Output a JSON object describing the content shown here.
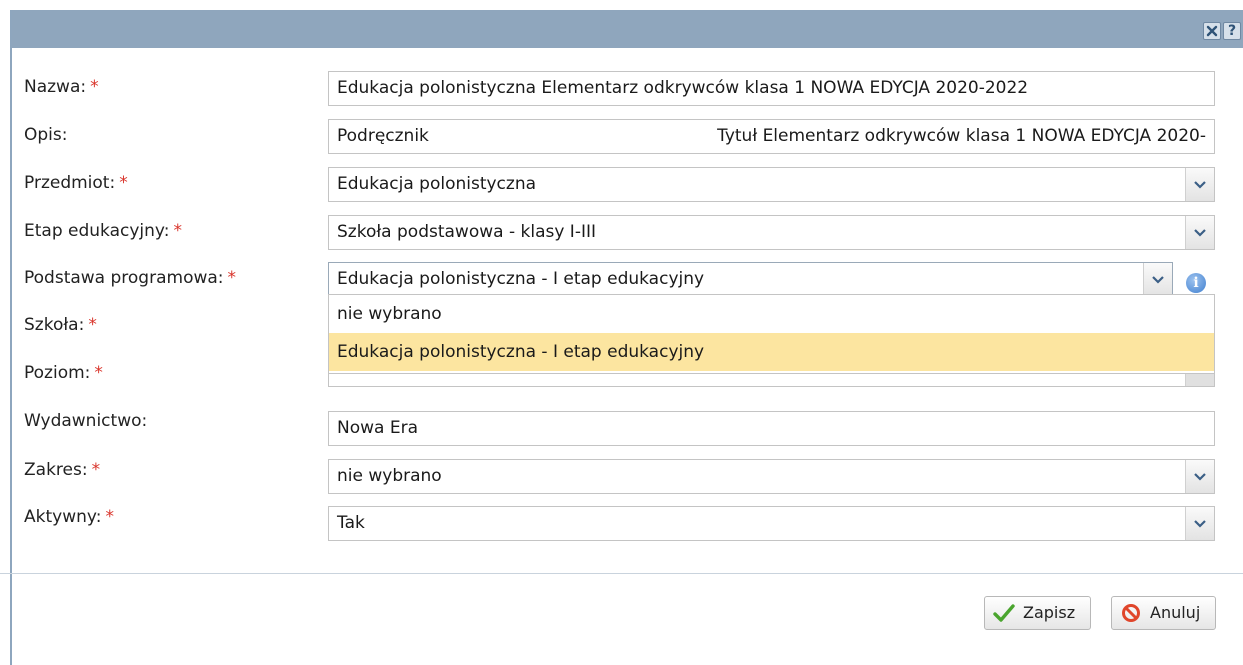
{
  "window": {
    "close_icon": "close-icon",
    "help_label": "?"
  },
  "fields": {
    "nazwa": {
      "label": "Nazwa:",
      "value": "Edukacja polonistyczna Elementarz odkrywców klasa 1 NOWA EDYCJA 2020-2022"
    },
    "opis": {
      "label": "Opis:",
      "value_left": "Podręcznik",
      "value_right": "Tytuł Elementarz odkrywców klasa 1 NOWA EDYCJA 2020-"
    },
    "przedmiot": {
      "label": "Przedmiot:",
      "value": "Edukacja polonistyczna"
    },
    "etap": {
      "label": "Etap edukacyjny:",
      "value": "Szkoła podstawowa - klasy I-III"
    },
    "podstawa": {
      "label": "Podstawa programowa:",
      "value": "Edukacja polonistyczna - I etap edukacyjny"
    },
    "szkola": {
      "label": "Szkoła:"
    },
    "poziom": {
      "label": "Poziom:"
    },
    "wydawnictwo": {
      "label": "Wydawnictwo:",
      "value": "Nowa Era"
    },
    "zakres": {
      "label": "Zakres:",
      "value": "nie wybrano"
    },
    "aktywny": {
      "label": "Aktywny:",
      "value": "Tak"
    }
  },
  "required_marker": "*",
  "dropdown": {
    "options": [
      {
        "label": "nie wybrano"
      },
      {
        "label": "Edukacja polonistyczna - I etap edukacyjny"
      }
    ],
    "highlighted": "Edukacja polonistyczna - I etap edukacyjny"
  },
  "buttons": {
    "save": "Zapisz",
    "cancel": "Anuluj"
  },
  "colors": {
    "titlebar": "#8fa6bd",
    "required": "#d9342b",
    "highlight": "#fce5a0"
  }
}
